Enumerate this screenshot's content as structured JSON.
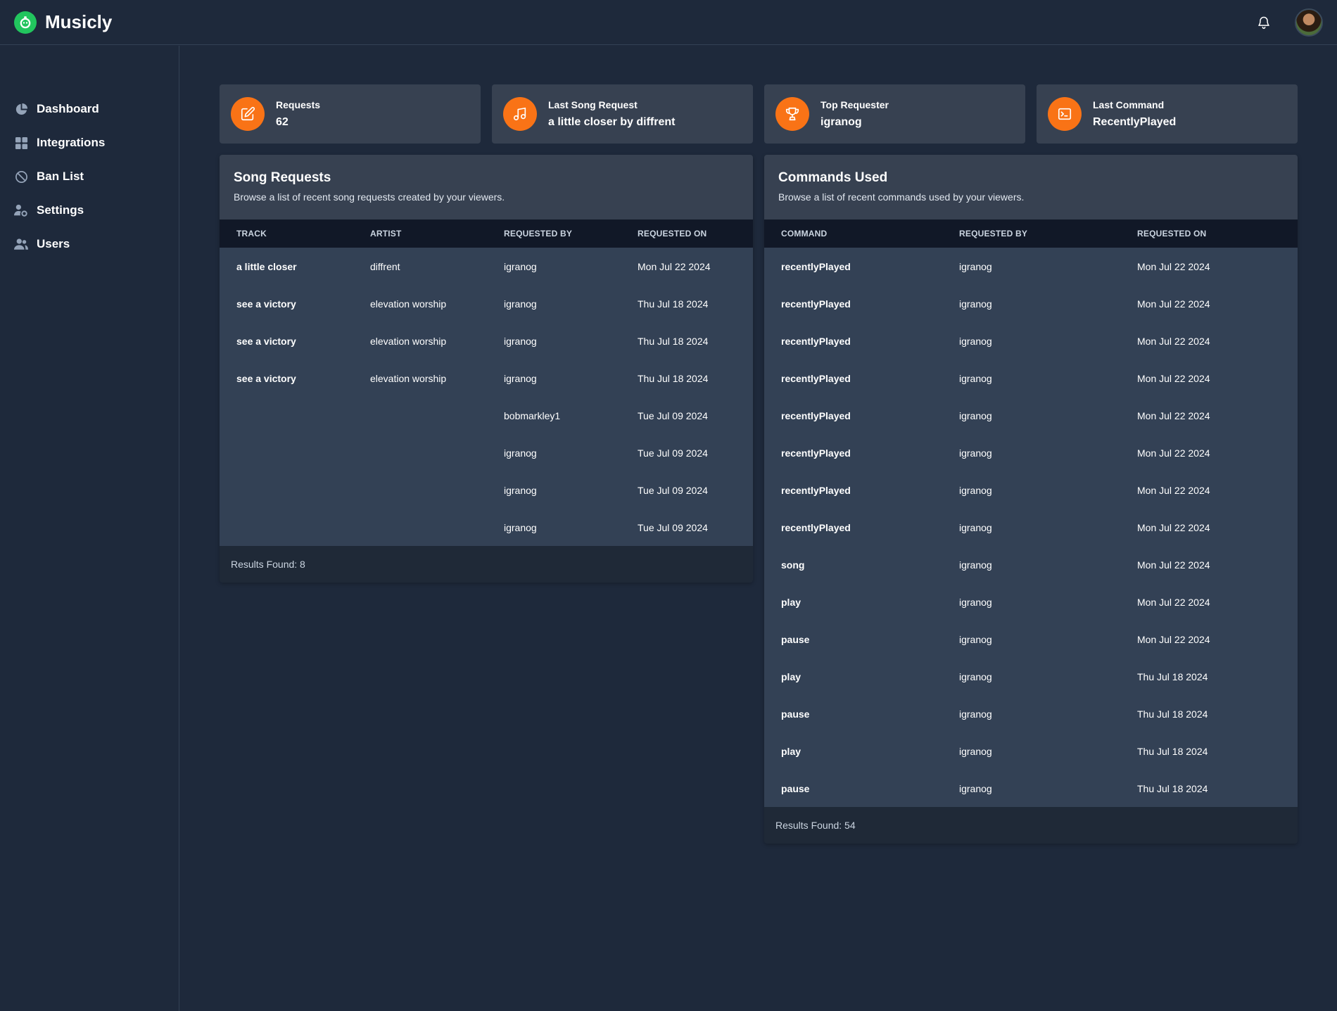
{
  "app": {
    "name": "Musicly"
  },
  "nav": [
    {
      "label": "Dashboard",
      "icon": "pie-chart-icon"
    },
    {
      "label": "Integrations",
      "icon": "grid-icon"
    },
    {
      "label": "Ban List",
      "icon": "ban-icon"
    },
    {
      "label": "Settings",
      "icon": "user-cog-icon"
    },
    {
      "label": "Users",
      "icon": "users-icon"
    }
  ],
  "stats": [
    {
      "label": "Requests",
      "value": "62",
      "icon": "edit-icon"
    },
    {
      "label": "Last Song Request",
      "value": "a little closer by diffrent",
      "icon": "music-note-icon"
    },
    {
      "label": "Top Requester",
      "value": "igranog",
      "icon": "trophy-icon"
    },
    {
      "label": "Last Command",
      "value": "RecentlyPlayed",
      "icon": "terminal-icon"
    }
  ],
  "song_requests": {
    "title": "Song Requests",
    "subtitle": "Browse a list of recent song requests created by your viewers.",
    "columns": [
      "Track",
      "Artist",
      "Requested By",
      "Requested On"
    ],
    "rows": [
      [
        "a little closer",
        "diffrent",
        "igranog",
        "Mon Jul 22 2024"
      ],
      [
        "see a victory",
        "elevation worship",
        "igranog",
        "Thu Jul 18 2024"
      ],
      [
        "see a victory",
        "elevation worship",
        "igranog",
        "Thu Jul 18 2024"
      ],
      [
        "see a victory",
        "elevation worship",
        "igranog",
        "Thu Jul 18 2024"
      ],
      [
        "",
        "",
        "bobmarkley1",
        "Tue Jul 09 2024"
      ],
      [
        "",
        "",
        "igranog",
        "Tue Jul 09 2024"
      ],
      [
        "",
        "",
        "igranog",
        "Tue Jul 09 2024"
      ],
      [
        "",
        "",
        "igranog",
        "Tue Jul 09 2024"
      ]
    ],
    "footer": "Results Found: 8"
  },
  "commands_used": {
    "title": "Commands Used",
    "subtitle": "Browse a list of recent commands used by your viewers.",
    "columns": [
      "Command",
      "Requested By",
      "Requested On"
    ],
    "rows": [
      [
        "recentlyPlayed",
        "igranog",
        "Mon Jul 22 2024"
      ],
      [
        "recentlyPlayed",
        "igranog",
        "Mon Jul 22 2024"
      ],
      [
        "recentlyPlayed",
        "igranog",
        "Mon Jul 22 2024"
      ],
      [
        "recentlyPlayed",
        "igranog",
        "Mon Jul 22 2024"
      ],
      [
        "recentlyPlayed",
        "igranog",
        "Mon Jul 22 2024"
      ],
      [
        "recentlyPlayed",
        "igranog",
        "Mon Jul 22 2024"
      ],
      [
        "recentlyPlayed",
        "igranog",
        "Mon Jul 22 2024"
      ],
      [
        "recentlyPlayed",
        "igranog",
        "Mon Jul 22 2024"
      ],
      [
        "song",
        "igranog",
        "Mon Jul 22 2024"
      ],
      [
        "play",
        "igranog",
        "Mon Jul 22 2024"
      ],
      [
        "pause",
        "igranog",
        "Mon Jul 22 2024"
      ],
      [
        "play",
        "igranog",
        "Thu Jul 18 2024"
      ],
      [
        "pause",
        "igranog",
        "Thu Jul 18 2024"
      ],
      [
        "play",
        "igranog",
        "Thu Jul 18 2024"
      ],
      [
        "pause",
        "igranog",
        "Thu Jul 18 2024"
      ]
    ],
    "footer": "Results Found: 54"
  },
  "colors": {
    "accent": "#f97316",
    "brand": "#22c55e",
    "background": "#1e293b",
    "card": "#374151"
  }
}
